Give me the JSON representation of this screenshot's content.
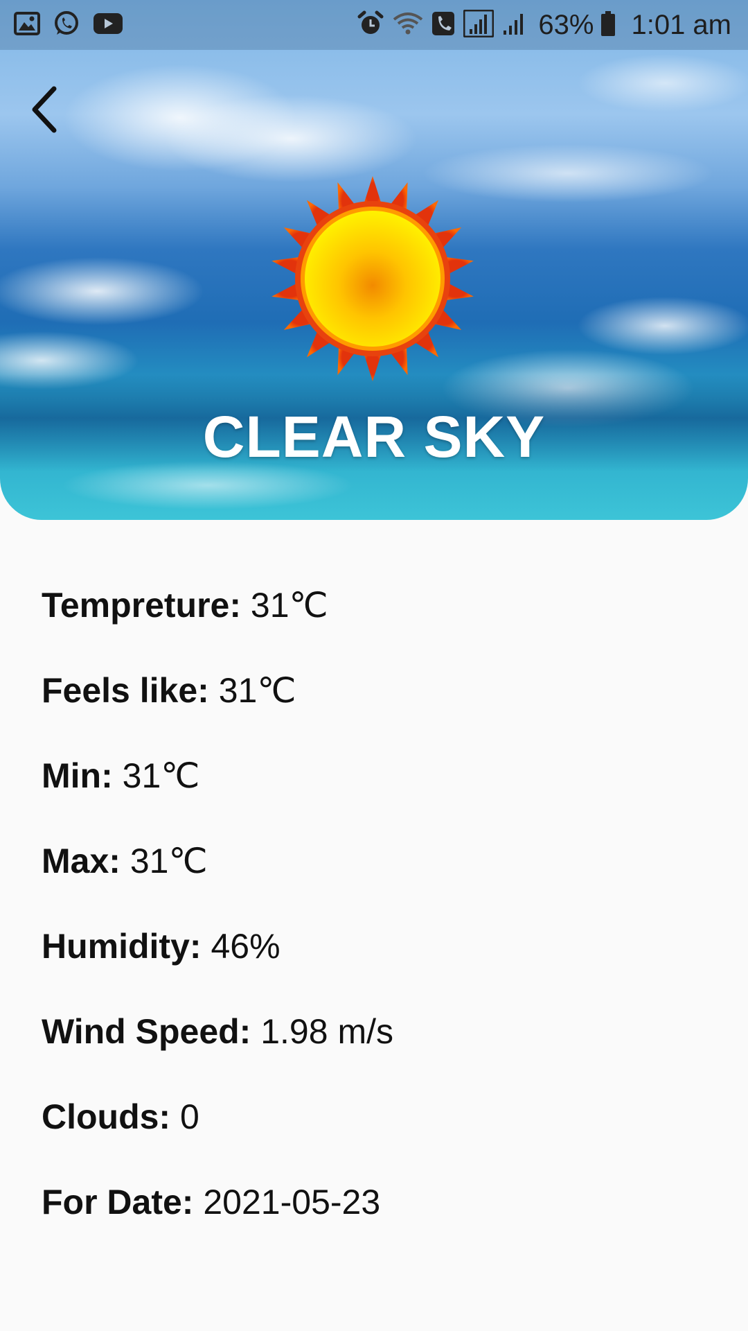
{
  "status_bar": {
    "left_icons": [
      "gallery-icon",
      "whatsapp-icon",
      "youtube-icon"
    ],
    "right_icons": [
      "alarm-icon",
      "wifi-icon",
      "wifi-calling-icon",
      "signal-sim1-icon",
      "signal-sim2-icon",
      "battery-icon"
    ],
    "battery": "63%",
    "time": "1:01 am"
  },
  "hero": {
    "back_icon": "chevron-left-icon",
    "weather_icon": "sun-icon",
    "condition": "CLEAR SKY"
  },
  "details": [
    {
      "label": "Tempreture:",
      "value": "31℃"
    },
    {
      "label": "Feels like:",
      "value": "31℃"
    },
    {
      "label": "Min:",
      "value": "31℃"
    },
    {
      "label": "Max:",
      "value": "31℃"
    },
    {
      "label": "Humidity:",
      "value": "46%"
    },
    {
      "label": "Wind Speed:",
      "value": "1.98 m/s"
    },
    {
      "label": "Clouds:",
      "value": "0"
    },
    {
      "label": "For Date:",
      "value": "2021-05-23"
    }
  ],
  "colors": {
    "background": "#fafafa",
    "title_text": "#ffffff",
    "body_text": "#111111"
  }
}
